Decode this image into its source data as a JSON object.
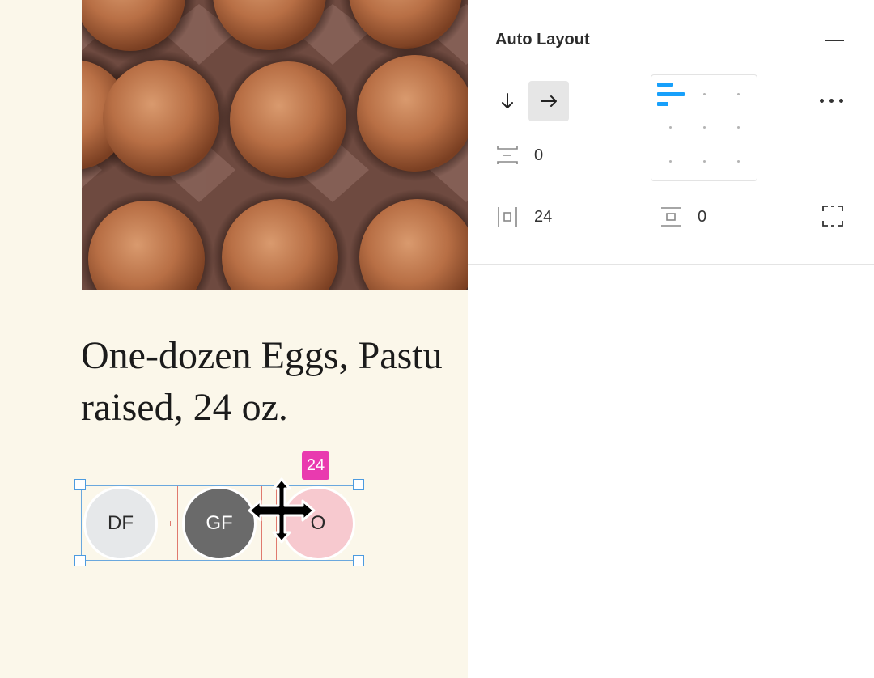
{
  "product": {
    "title_line1": "One-dozen Eggs, Pastu",
    "title_line2": "raised, 24 oz."
  },
  "tags": [
    {
      "label": "DF"
    },
    {
      "label": "GF"
    },
    {
      "label": "O"
    }
  ],
  "selection": {
    "spacing_badge": "24"
  },
  "panel": {
    "title": "Auto Layout",
    "direction": {
      "selected": "horizontal",
      "options": [
        "vertical",
        "horizontal"
      ]
    },
    "alignment": {
      "selected": "top-left"
    },
    "spacing_between": "0",
    "horizontal_padding": "24",
    "vertical_padding": "0"
  },
  "colors": {
    "canvas_bg": "#fbf7ea",
    "badge": "#e93aaf",
    "selection": "#6aa8de",
    "alignment_active": "#18a0fb",
    "tag_df": "#e6e8ea",
    "tag_gf": "#6a6a6a",
    "tag_o": "#f7c9cf"
  },
  "icons": [
    "arrow-down-icon",
    "arrow-right-icon",
    "spacing-between-icon",
    "horizontal-padding-icon",
    "vertical-padding-icon",
    "resizing-icon",
    "more-options-icon",
    "collapse-icon",
    "move-cursor-icon"
  ]
}
